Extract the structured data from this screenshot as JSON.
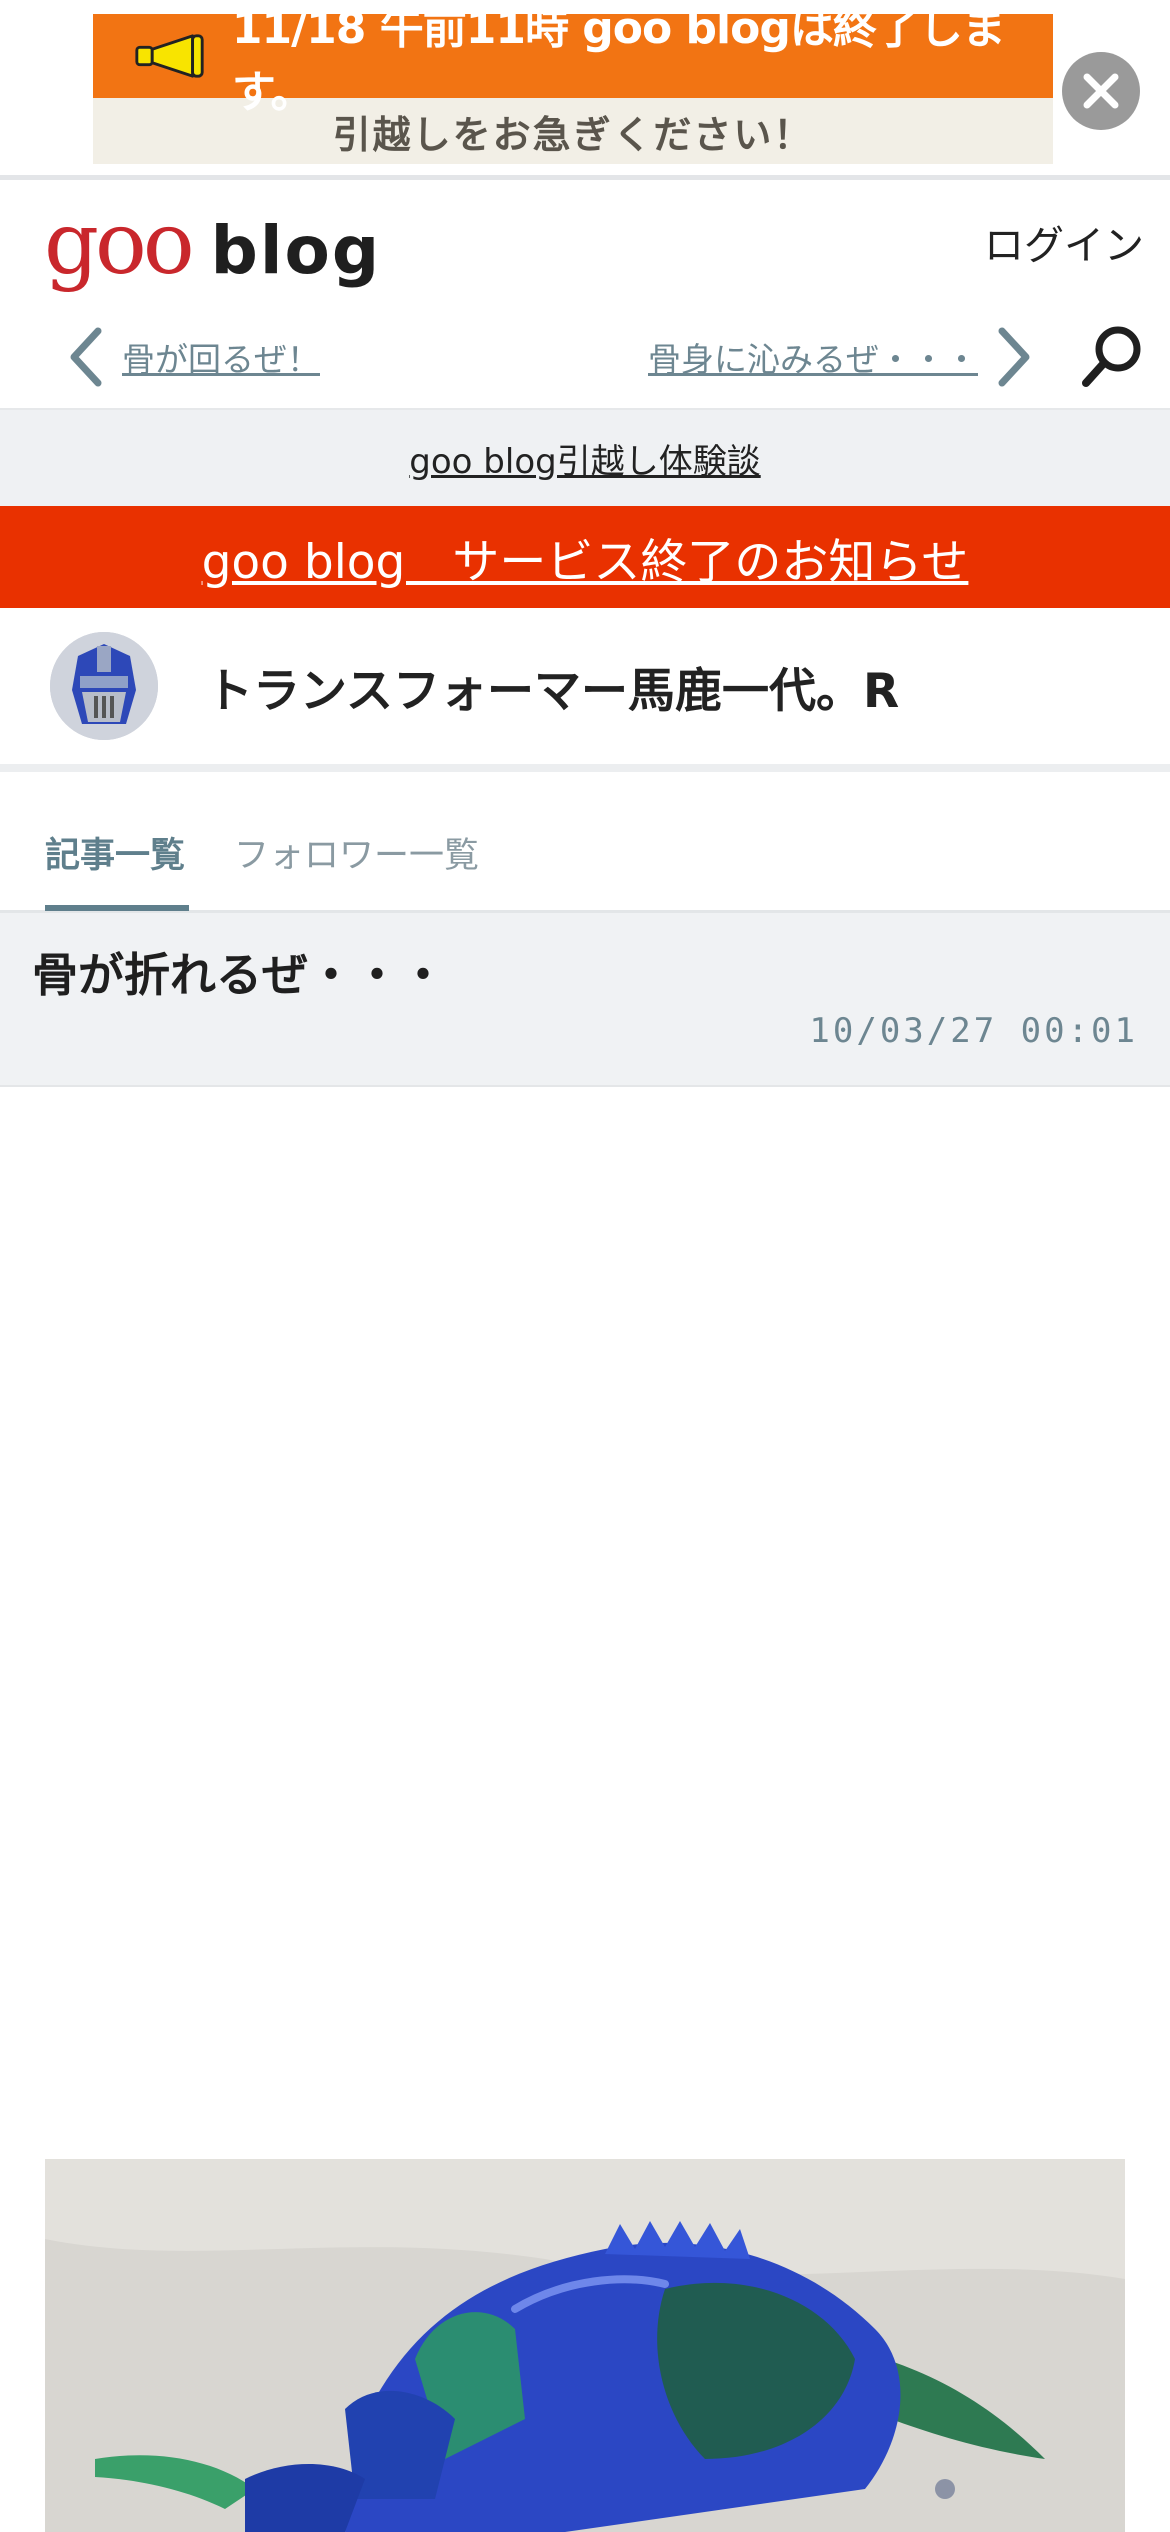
{
  "notice": {
    "line1": "11/18 午前11時 goo blogは終了します。",
    "line2": "引越しをお急ぎください！",
    "close_icon": "close-icon"
  },
  "header": {
    "logo_goo": "goo",
    "logo_blog": "blog",
    "login": "ログイン"
  },
  "nav": {
    "prev_label": "骨が回るぜ！",
    "next_label": "骨身に沁みるぜ・・・",
    "icons": [
      "chevron-left-icon",
      "chevron-right-icon",
      "search-icon"
    ]
  },
  "experience_link": "goo blog引越し体験談",
  "service_end_link": "goo blog　サービス終了のお知らせ",
  "blog": {
    "title": "トランスフォーマー馬鹿一代。R"
  },
  "tabs": [
    {
      "label": "記事一覧",
      "active": true
    },
    {
      "label": "フォロワー一覧",
      "active": false
    }
  ],
  "article": {
    "title": "骨が折れるぜ・・・",
    "date": "10/03/27 00:01"
  },
  "colors": {
    "notice_orange": "#f27413",
    "service_red": "#e93100",
    "logo_red": "#c9272c",
    "accent_teal": "#5f7f8c"
  }
}
